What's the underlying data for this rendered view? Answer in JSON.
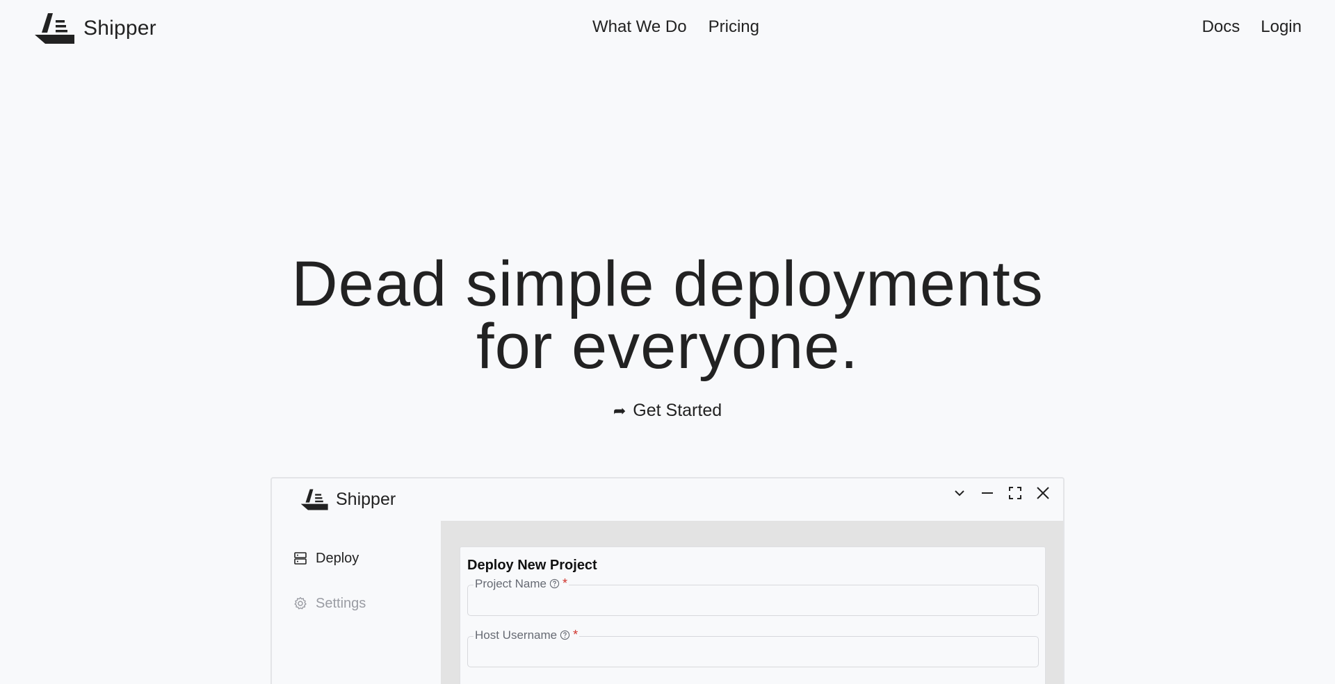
{
  "brand": {
    "name": "Shipper",
    "icon": "ship-logo-icon"
  },
  "nav": {
    "center": [
      "What We Do",
      "Pricing"
    ],
    "right": [
      "Docs",
      "Login"
    ]
  },
  "hero": {
    "line1": "Dead simple deployments",
    "line2": "for everyone.",
    "cta": {
      "arrow": "➦",
      "label": "Get Started"
    }
  },
  "app_window": {
    "brand_name": "Shipper",
    "controls": [
      "chevron-down-icon",
      "minimize-icon",
      "maximize-icon",
      "close-icon"
    ],
    "sidebar": [
      {
        "label": "Deploy",
        "icon": "server-icon",
        "active": true
      },
      {
        "label": "Settings",
        "icon": "gear-icon",
        "active": false
      }
    ],
    "form": {
      "title": "Deploy New Project",
      "fields": [
        {
          "label": "Project Name",
          "required_mark": "*",
          "value": "",
          "placeholder": ""
        },
        {
          "label": "Host Username",
          "required_mark": "*",
          "value": "",
          "placeholder": ""
        }
      ]
    }
  },
  "colors": {
    "background": "#f8f9fb",
    "text": "#222222",
    "muted": "#9a9ca3",
    "panel": "#e3e3e3",
    "required": "#d0342c"
  }
}
